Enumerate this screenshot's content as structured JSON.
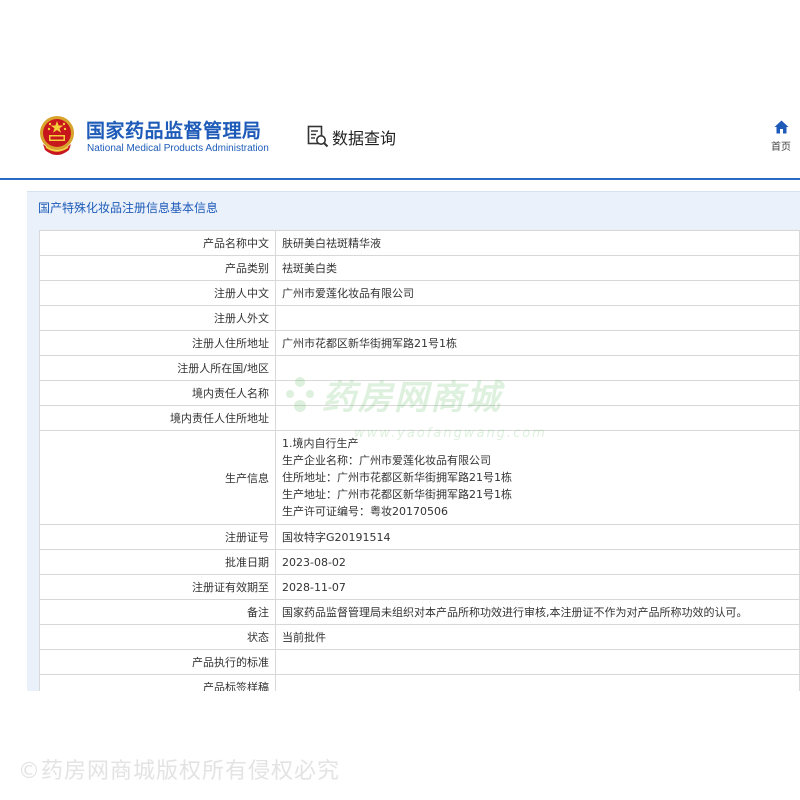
{
  "header": {
    "site_name_cn": "国家药品监督管理局",
    "site_name_en": "National Medical Products Administration",
    "query_label": "数据查询",
    "home_label": "首页",
    "emblem_icon": "national-emblem-icon",
    "query_icon": "search-document-icon",
    "home_icon": "home-icon"
  },
  "panel": {
    "title": "国产特殊化妆品注册信息基本信息"
  },
  "rows": [
    {
      "label": "产品名称中文",
      "value": "肤研美白祛斑精华液"
    },
    {
      "label": "产品类别",
      "value": "祛斑美白类"
    },
    {
      "label": "注册人中文",
      "value": "广州市爱莲化妆品有限公司"
    },
    {
      "label": "注册人外文",
      "value": ""
    },
    {
      "label": "注册人住所地址",
      "value": "广州市花都区新华街拥军路21号1栋"
    },
    {
      "label": "注册人所在国/地区",
      "value": ""
    },
    {
      "label": "境内责任人名称",
      "value": ""
    },
    {
      "label": "境内责任人住所地址",
      "value": ""
    },
    {
      "label": "生产信息",
      "lines": [
        "1.境内自行生产",
        "生产企业名称：广州市爱莲化妆品有限公司",
        "住所地址：广州市花都区新华街拥军路21号1栋",
        "生产地址：广州市花都区新华街拥军路21号1栋",
        "生产许可证编号：粤妆20170506"
      ]
    },
    {
      "label": "注册证号",
      "value": "国妆特字G20191514"
    },
    {
      "label": "批准日期",
      "value": "2023-08-02"
    },
    {
      "label": "注册证有效期至",
      "value": "2028-11-07"
    },
    {
      "label": "备注",
      "value": "国家药品监督管理局未组织对本产品所称功效进行审核,本注册证不作为对产品所称功效的认可。"
    },
    {
      "label": "状态",
      "value": "当前批件"
    },
    {
      "label": "产品执行的标准",
      "value": ""
    },
    {
      "label": "产品标签样稿",
      "value": ""
    }
  ],
  "watermark": {
    "main": "药房网商城",
    "url": "www.yaofangwang.com"
  },
  "footer_watermark": "©药房网商城版权所有侵权必究",
  "colors": {
    "brand_blue": "#1e5bb8",
    "header_line": "#2a6ac4",
    "panel_bg": "#eaf1fa",
    "watermark_green": "#6cbf6c"
  }
}
